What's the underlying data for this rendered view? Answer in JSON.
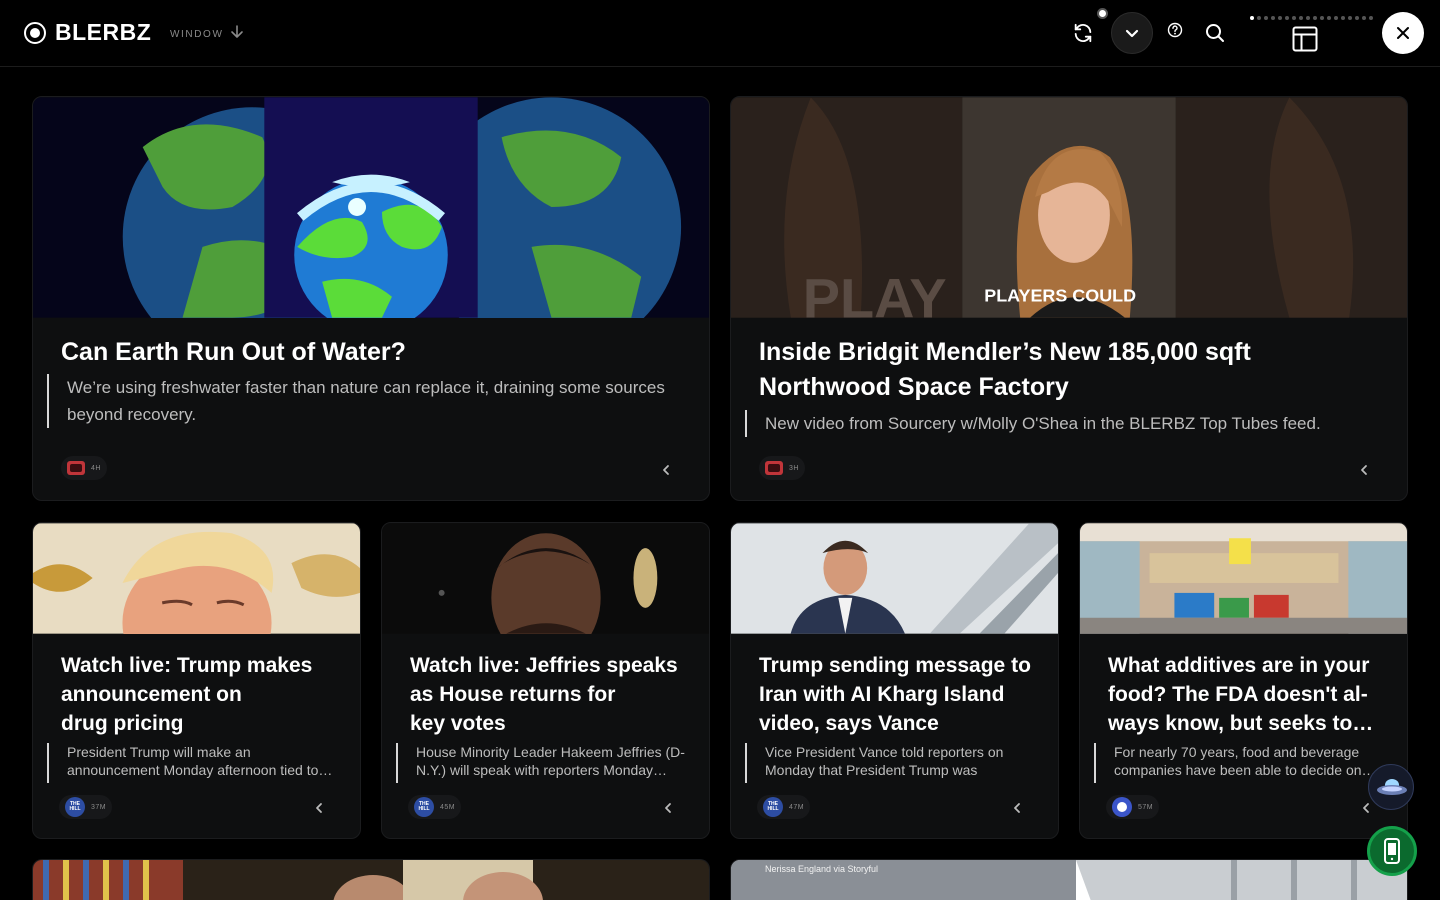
{
  "header": {
    "brand": "BLERBZ",
    "window_label": "WINDOW"
  },
  "icons": {
    "logo": "record-logo-icon",
    "window_arrow": "arrow-down-icon",
    "refresh": "refresh-icon",
    "dropdown": "chevron-down-icon",
    "help": "help-circle-icon",
    "search": "search-icon",
    "layout": "layout-panel-icon",
    "close": "close-icon"
  },
  "featured": [
    {
      "title": "Can Earth Run Out of Water?",
      "description": "We’re using freshwater faster than nature can replace it, draining some sources beyond recovery.",
      "time": "4H",
      "source_icon": "tv-icon"
    },
    {
      "title": "Inside Bridgit Mendler’s New 185,000 sqft Northwood Space Factory",
      "description": "New video from Sourcery w/Molly O'Shea in the BLERBZ Top Tubes feed.",
      "time": "3H",
      "source_icon": "tv-icon",
      "thumb_overlay": "PLAYERS COULD",
      "thumb_bg_text": "PLAY"
    }
  ],
  "stories": [
    {
      "title_lines": [
        "Watch live: Trump makes",
        "announcement on",
        "drug pricing"
      ],
      "description": "President Trump will make an announcement Monday afternoon tied to…",
      "time": "37M",
      "source_label": "THE HILL"
    },
    {
      "title_lines": [
        "Watch live: Jeffries speaks",
        "as House returns for",
        "key votes"
      ],
      "description": "House Minority Leader Hakeem Jeffries (D-N.Y.) will speak with reporters Monday…",
      "time": "45M",
      "source_label": "THE HILL"
    },
    {
      "title_lines": [
        "Trump sending message to",
        "Iran with AI Kharg Island",
        "video, says Vance"
      ],
      "description": "Vice President Vance told reporters on Monday that President Trump was sendin…",
      "time": "47M",
      "source_label": "THE HILL"
    },
    {
      "title_lines": [
        "What additives are in your",
        "food? The FDA doesn't al-",
        "ways know, but seeks to…"
      ],
      "description": "For nearly 70 years, food and beverage companies have been able to decide on…",
      "time": "57M",
      "source_label": ""
    }
  ],
  "bottom_row": {
    "caption": "Nerissa England via Storyful"
  },
  "colors": {
    "background": "#000000",
    "card": "#0e0f10",
    "accent_green": "#14a04a",
    "hill_blue": "#2d4da3"
  }
}
